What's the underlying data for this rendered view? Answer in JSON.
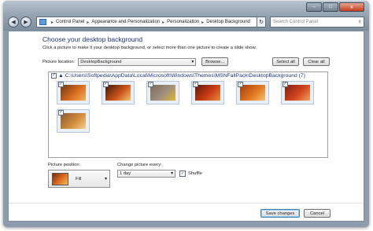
{
  "window": {
    "minimize_glyph": "–",
    "maximize_glyph": "□",
    "close_glyph": "✕"
  },
  "nav": {
    "back_glyph": "◀",
    "forward_glyph": "▶",
    "breadcrumb": [
      "Control Panel",
      "Appearance and Personalization",
      "Personalization",
      "Desktop Background"
    ],
    "search_placeholder": "Search Control Panel"
  },
  "main": {
    "title": "Choose your desktop background",
    "description": "Click a picture to make it your desktop background, or select more than one picture to create a slide show.",
    "picture_location_label": "Picture location:",
    "picture_location_value": "DesktopBackground",
    "browse_label": "Browse...",
    "select_all_label": "Select all",
    "clear_all_label": "Clear all",
    "gallery_path": "C:\\Users\\Softpedia\\AppData\\Local\\Microsoft\\Windows\\Themes\\MSNFallPack\\DesktopBackground (7)",
    "thumbnails": [
      {
        "name": "autumn-forest-path",
        "colors": [
          "#6b3a12",
          "#d86a1f",
          "#f2b456"
        ],
        "checked": true
      },
      {
        "name": "autumn-sunlit-trees",
        "colors": [
          "#3d1a0a",
          "#c8501a",
          "#f6c36a"
        ],
        "checked": true
      },
      {
        "name": "pebbles-yellow-leaf",
        "colors": [
          "#7c6a5a",
          "#a08f7d",
          "#e0b62a"
        ],
        "checked": true
      },
      {
        "name": "red-autumn-trees",
        "colors": [
          "#5a1a08",
          "#c93b14",
          "#e88c3c"
        ],
        "checked": true
      },
      {
        "name": "orange-leaves-closeup",
        "colors": [
          "#a83a10",
          "#e0761f",
          "#f7c26a"
        ],
        "checked": true
      },
      {
        "name": "autumn-lake-trees",
        "colors": [
          "#802010",
          "#d2451c",
          "#f0a060"
        ],
        "checked": true
      },
      {
        "name": "autumn-maple-branch",
        "colors": [
          "#8a5a30",
          "#d08a3a",
          "#f4d08a"
        ],
        "checked": true
      }
    ],
    "picture_position_label": "Picture position:",
    "picture_position_value": "Fill",
    "change_picture_label": "Change picture every:",
    "change_picture_value": "1 day",
    "shuffle_label": "Shuffle",
    "shuffle_checked": true,
    "save_label": "Save changes",
    "cancel_label": "Cancel"
  }
}
